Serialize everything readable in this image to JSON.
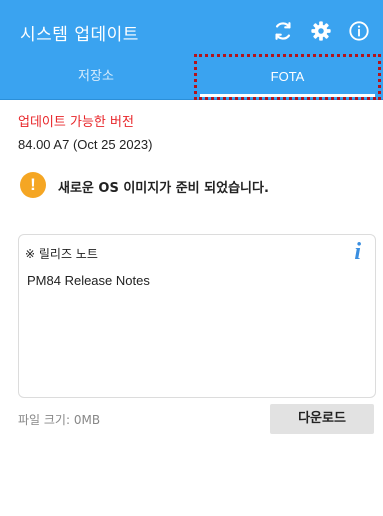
{
  "app": {
    "title": "시스템 업데이트",
    "colors": {
      "primary": "#3aa3f0",
      "accent_red": "#e8262a",
      "warning": "#f5a623",
      "info": "#3a8ee0"
    }
  },
  "toolbar": {
    "icons": [
      "refresh-icon",
      "gear-icon",
      "info-circle-icon"
    ]
  },
  "tabs": [
    {
      "label": "저장소",
      "selected": false
    },
    {
      "label": "FOTA",
      "selected": true
    }
  ],
  "main": {
    "available_label": "업데이트 가능한 버전",
    "version": "84.00 A7 (Oct 25 2023)",
    "alert_icon_glyph": "!",
    "alert_text": "새로운 OS 이미지가 준비 되었습니다.",
    "notes": {
      "label": "※ 릴리즈 노트",
      "info_glyph": "i",
      "body": "PM84 Release Notes"
    },
    "file_size": "파일 크기: 0MB",
    "download_label": "다운로드"
  }
}
